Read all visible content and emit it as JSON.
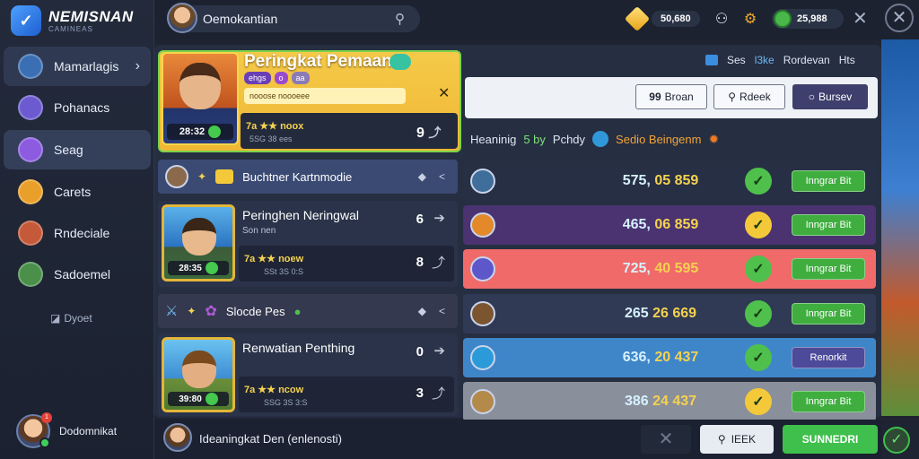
{
  "app": {
    "logo_title": "NEMISNAN",
    "logo_sub": "CAMINEAS"
  },
  "sidebar": {
    "items": [
      {
        "label": "Mamarlagis",
        "icon": "avatar-icon",
        "color": "#3b6fb3"
      },
      {
        "label": "Pohanacs",
        "icon": "orb-icon",
        "color": "#6c5bd0"
      },
      {
        "label": "Seag",
        "icon": "leaf-icon",
        "color": "#8c5be0"
      },
      {
        "label": "Carets",
        "icon": "mask-icon",
        "color": "#e8a02a"
      },
      {
        "label": "Rndeciale",
        "icon": "character-icon",
        "color": "#c45a3a"
      },
      {
        "label": "Sadoemel",
        "icon": "elf-icon",
        "color": "#4a8f4a"
      }
    ],
    "extra": "Dyoet",
    "user_name": "Dodomnikat",
    "user_notif": "1"
  },
  "topbar": {
    "search_value": "Oemokantian",
    "gems": "50,680",
    "coins": "25,988"
  },
  "featured": {
    "title": "Peringkat Pemaan",
    "tags": [
      "ehgs",
      "o",
      "aa"
    ],
    "message": "nooose noooeee",
    "level": "28:32",
    "stat_line1": "7a ★★ noox",
    "stat_line2": "5SG 38 ees",
    "stat_num": "9"
  },
  "right_header": {
    "tabs": [
      "Ses",
      "l3ke",
      "Rordevan",
      "Hts"
    ],
    "filters": [
      "Broan",
      "Rdeek",
      "Bursev"
    ],
    "sub_label": "Heaninig",
    "sub_green": "5 by",
    "sub_mid": "Pchdy",
    "sub_orange": "Sedio Beingenm"
  },
  "list": {
    "group1": {
      "title": "Buchtner Kartnmodie"
    },
    "card1": {
      "title": "Peringhen Neringwal",
      "sub": "Son nen",
      "level": "28:35",
      "stat1": "7a ★★ noew",
      "stat2": "SSt 3S 0:S",
      "num1": "6",
      "num2": "8"
    },
    "group2": {
      "title": "Slocde Pes"
    },
    "card2": {
      "title": "Renwatian Penthing",
      "sub": "",
      "level": "39:80",
      "stat1": "7a ★★ ncow",
      "stat2": "SSG 3S 3:S",
      "num1": "0",
      "num2": "3"
    }
  },
  "rankings": [
    {
      "score_a": "575,",
      "score_b": "05 859",
      "btn": "Inngrar Bit",
      "row_color": "#272f44",
      "avatar_color": "#3f6e9a",
      "check_color": "#4fc04c",
      "btn_color": "#3fae3f",
      "check_glyph": "✓"
    },
    {
      "score_a": "465,",
      "score_b": "06 859",
      "btn": "Inngrar Bit",
      "row_color": "#4a3370",
      "avatar_color": "#e3892a",
      "check_color": "#f3c93a",
      "btn_color": "#3fae3f",
      "check_glyph": "✓"
    },
    {
      "score_a": "725,",
      "score_b": "40 595",
      "btn": "Inngrar Bit",
      "row_color": "#f06a6a",
      "avatar_color": "#5e57c9",
      "check_color": "#4fc04c",
      "btn_color": "#3fae3f",
      "check_glyph": "✓"
    },
    {
      "score_a": "265",
      "score_b": "26 669",
      "btn": "Inngrar Bit",
      "row_color": "#313a54",
      "avatar_color": "#7a5530",
      "check_color": "#4fc04c",
      "btn_color": "#3fae3f",
      "check_glyph": "✓"
    },
    {
      "score_a": "636,",
      "score_b": "20 437",
      "btn": "Renorkit",
      "row_color": "#3f86c9",
      "avatar_color": "#2b9ad9",
      "check_color": "#4fc04c",
      "btn_color": "#4d4a9a",
      "check_glyph": "✓"
    },
    {
      "score_a": "386",
      "score_b": "24 437",
      "btn": "Inngrar Bit",
      "row_color": "#8a8f9c",
      "avatar_color": "#b48a4a",
      "check_color": "#f3c93a",
      "btn_color": "#3fae3f",
      "check_glyph": "✓"
    }
  ],
  "bottom": {
    "text": "Ideaningkat Den (enlenosti)",
    "btn1": "IEEK",
    "btn2": "SUNNEDRI"
  }
}
